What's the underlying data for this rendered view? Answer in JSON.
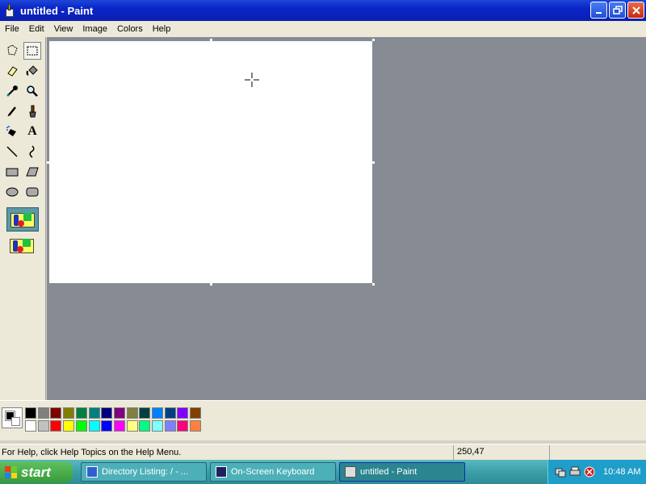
{
  "window": {
    "title": "untitled - Paint"
  },
  "menu": [
    "File",
    "Edit",
    "View",
    "Image",
    "Colors",
    "Help"
  ],
  "tools": [
    "free-form-select",
    "select",
    "eraser",
    "fill-with-color",
    "pick-color",
    "magnifier",
    "pencil",
    "brush",
    "airbrush",
    "text",
    "line",
    "curve",
    "rectangle",
    "polygon",
    "ellipse",
    "rounded-rectangle"
  ],
  "palette": {
    "foreground": "#000000",
    "background": "#ffffff",
    "top_row": [
      "#000000",
      "#808080",
      "#800000",
      "#808000",
      "#008040",
      "#008080",
      "#000080",
      "#800080",
      "#808040",
      "#004040",
      "#0080ff",
      "#004080",
      "#8000ff",
      "#804000"
    ],
    "bottom_row": [
      "#ffffff",
      "#c0c0c0",
      "#ff0000",
      "#ffff00",
      "#00ff00",
      "#00ffff",
      "#0000ff",
      "#ff00ff",
      "#ffff80",
      "#00ff80",
      "#80ffff",
      "#8080ff",
      "#ff0080",
      "#ff8040"
    ]
  },
  "status": {
    "help": "For Help, click Help Topics on the Help Menu.",
    "coords": "250,47"
  },
  "taskbar": {
    "start": "start",
    "tasks": [
      {
        "label": "Directory Listing: / - ..."
      },
      {
        "label": "On-Screen Keyboard"
      },
      {
        "label": "untitled - Paint"
      }
    ],
    "clock": "10:48 AM"
  }
}
